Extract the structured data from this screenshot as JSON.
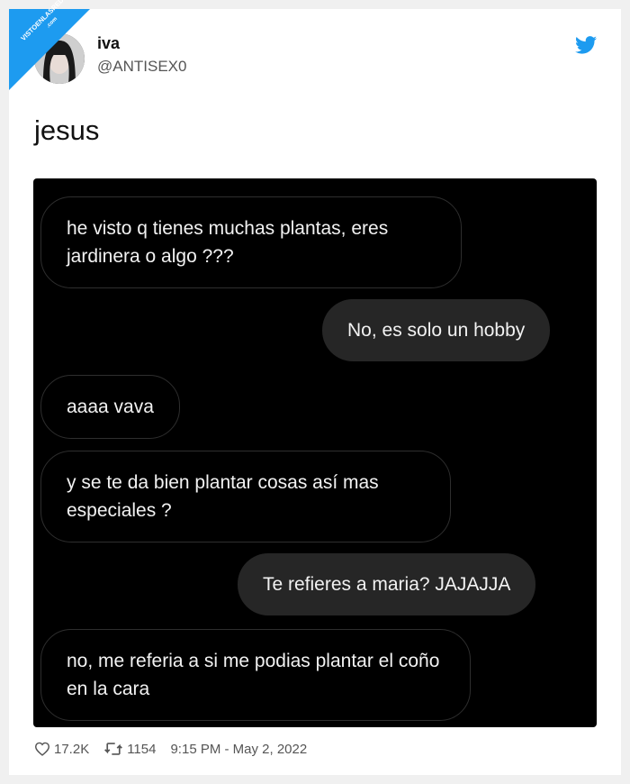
{
  "watermark": {
    "text": "VISTOENLASREDES",
    "sub": ".com"
  },
  "tweet": {
    "display_name": "iva",
    "handle": "@ANTISEX0",
    "text": "jesus",
    "likes": "17.2K",
    "retweets": "1154",
    "timestamp": "9:15 PM - May 2, 2022"
  },
  "chat": {
    "messages": [
      {
        "direction": "received",
        "text": "he visto q tienes muchas plantas, eres jardinera o algo ???"
      },
      {
        "direction": "sent",
        "text": "No, es solo un hobby"
      },
      {
        "direction": "received",
        "text": "aaaa vava"
      },
      {
        "direction": "received",
        "text": "y se te da bien plantar cosas así mas especiales ?"
      },
      {
        "direction": "sent",
        "text": "Te refieres a maria? JAJAJJA"
      },
      {
        "direction": "received",
        "text": "no, me referia a si me podias plantar el coño en la cara"
      }
    ]
  },
  "icons": {
    "bird": "twitter-bird-icon",
    "like": "heart-icon",
    "retweet": "retweet-icon"
  },
  "colors": {
    "twitter_blue": "#1d9bf0",
    "chat_bg": "#000000",
    "sent_bubble": "#262626"
  }
}
